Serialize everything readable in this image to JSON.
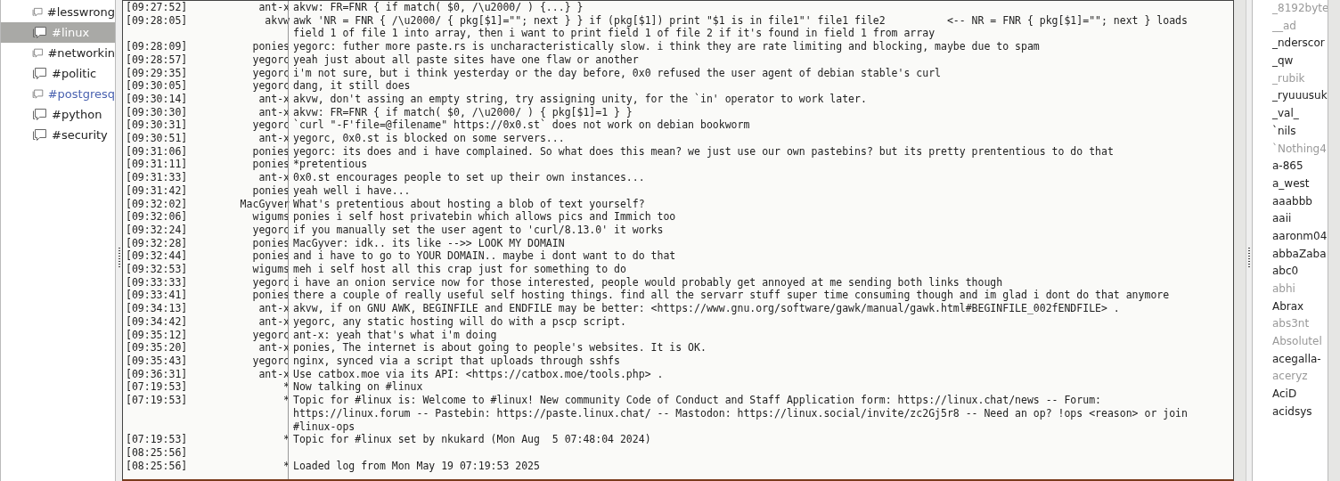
{
  "channels": [
    {
      "label": "#lesswrong",
      "selected": false,
      "activity": false
    },
    {
      "label": "#linux",
      "selected": true,
      "activity": false
    },
    {
      "label": "#networkin",
      "selected": false,
      "activity": false
    },
    {
      "label": "#politic",
      "selected": false,
      "activity": false
    },
    {
      "label": "#postgresq",
      "selected": false,
      "activity": true
    },
    {
      "label": "#python",
      "selected": false,
      "activity": false
    },
    {
      "label": "#security",
      "selected": false,
      "activity": false
    }
  ],
  "messages": [
    {
      "time": "[09:27:52]",
      "nick": "ant-x",
      "text": "akvw: FR=FNR { if match( $0, /\\u2000/ ) {...} }"
    },
    {
      "time": "[09:28:05]",
      "nick": "akvw",
      "text": "awk 'NR = FNR { /\\u2000/ { pkg[$1]=\"\"; next } } if (pkg[$1]) print \"$1 is in file1\"' file1 file2          <-- NR = FNR { pkg[$1]=\"\"; next } loads field 1 of file 1 into array, then i want to print field 1 of file 2 if it's found in field 1 from array"
    },
    {
      "time": "[09:28:09]",
      "nick": "ponies",
      "text": "yegorc: futher more paste.rs is uncharacteristically slow. i think they are rate limiting and blocking, maybe due to spam"
    },
    {
      "time": "[09:28:57]",
      "nick": "yegorc",
      "text": "yeah just about all paste sites have one flaw or another"
    },
    {
      "time": "[09:29:35]",
      "nick": "yegorc",
      "text": "i'm not sure, but i think yesterday or the day before, 0x0 refused the user agent of debian stable's curl"
    },
    {
      "time": "[09:30:05]",
      "nick": "yegorc",
      "text": "dang, it still does"
    },
    {
      "time": "[09:30:14]",
      "nick": "ant-x",
      "text": "akvw, don't assing an empty string, try assigning unity, for the `in' operator to work later."
    },
    {
      "time": "[09:30:30]",
      "nick": "ant-x",
      "text": "akvw: FR=FNR { if match( $0, /\\u2000/ ) { pkg[$1]=1 } }"
    },
    {
      "time": "[09:30:31]",
      "nick": "yegorc",
      "text": "`curl \"-F'file=@filename\" https://0x0.st` does not work on debian bookworm"
    },
    {
      "time": "[09:30:51]",
      "nick": "ant-x",
      "text": "yegorc, 0x0.st is blocked on some servers..."
    },
    {
      "time": "[09:31:06]",
      "nick": "ponies",
      "text": "yegorc: its does and i have complained. So what does this mean? we just use our own pastebins? but its pretty prententious to do that"
    },
    {
      "time": "[09:31:11]",
      "nick": "ponies",
      "text": "*pretentious"
    },
    {
      "time": "[09:31:33]",
      "nick": "ant-x",
      "text": "0x0.st encourages people to set up their own instances..."
    },
    {
      "time": "[09:31:42]",
      "nick": "ponies",
      "text": "yeah well i have..."
    },
    {
      "time": "[09:32:02]",
      "nick": "MacGyver",
      "text": "What's pretentious about hosting a blob of text yourself?"
    },
    {
      "time": "[09:32:06]",
      "nick": "wigums",
      "text": "ponies i self host privatebin which allows pics and Immich too"
    },
    {
      "time": "[09:32:24]",
      "nick": "yegorc",
      "text": "if you manually set the user agent to 'curl/8.13.0' it works"
    },
    {
      "time": "[09:32:28]",
      "nick": "ponies",
      "text": "MacGyver: idk.. its like -->> LOOK MY DOMAIN"
    },
    {
      "time": "[09:32:44]",
      "nick": "ponies",
      "text": "and i have to go to YOUR DOMAIN.. maybe i dont want to do that"
    },
    {
      "time": "[09:32:53]",
      "nick": "wigums",
      "text": "meh i self host all this crap just for something to do"
    },
    {
      "time": "[09:33:33]",
      "nick": "yegorc",
      "text": "i have an onion service now for those interested, people would probably get annoyed at me sending both links though"
    },
    {
      "time": "[09:33:41]",
      "nick": "ponies",
      "text": "there a couple of really useful self hosting things. find all the servarr stuff super time consuming though and im glad i dont do that anymore"
    },
    {
      "time": "[09:34:13]",
      "nick": "ant-x",
      "text": "akvw, if on GNU AWK, BEGINFILE and ENDFILE may be better: <https://www.gnu.org/software/gawk/manual/gawk.html#BEGINFILE_002fENDFILE> ."
    },
    {
      "time": "[09:34:42]",
      "nick": "ant-x",
      "text": "yegorc, any static hosting will do with a pscp script."
    },
    {
      "time": "[09:35:12]",
      "nick": "yegorc",
      "text": "ant-x: yeah that's what i'm doing"
    },
    {
      "time": "[09:35:20]",
      "nick": "ant-x",
      "text": "ponies, The internet is about going to people's websites. It is OK."
    },
    {
      "time": "[09:35:43]",
      "nick": "yegorc",
      "text": "nginx, synced via a script that uploads through sshfs"
    },
    {
      "time": "[09:36:31]",
      "nick": "ant-x",
      "text": "Use catbox.moe via its API: <https://catbox.moe/tools.php> ."
    },
    {
      "time": "[07:19:53]",
      "nick": "*",
      "text": "Now talking on #linux"
    },
    {
      "time": "[07:19:53]",
      "nick": "*",
      "text": "Topic for #linux is: Welcome to #linux! New community Code of Conduct and Staff Application form: https://linux.chat/news -- Forum: https://linux.forum -- Pastebin: https://paste.linux.chat/ -- Mastodon: https://linux.social/invite/zc2Gj5r8 -- Need an op? !ops <reason> or join #linux-ops"
    },
    {
      "time": "[07:19:53]",
      "nick": "*",
      "text": "Topic for #linux set by nkukard (Mon Aug  5 07:48:04 2024)"
    },
    {
      "time": "[08:25:56]"
    },
    {
      "time": "[08:25:56]",
      "nick": "*",
      "text": "Loaded log from Mon May 19 07:19:53 2025"
    }
  ],
  "nicks": [
    {
      "name": "_8192byte",
      "away": true
    },
    {
      "name": "__ad",
      "away": true
    },
    {
      "name": "_nderscor",
      "away": false
    },
    {
      "name": "_qw",
      "away": false
    },
    {
      "name": "_rubik",
      "away": true
    },
    {
      "name": "_ryuuusuk",
      "away": false
    },
    {
      "name": "_val_",
      "away": false
    },
    {
      "name": "`nils",
      "away": false
    },
    {
      "name": "`Nothing4",
      "away": true
    },
    {
      "name": "a-865",
      "away": false
    },
    {
      "name": "a_west",
      "away": false
    },
    {
      "name": "aaabbb",
      "away": false
    },
    {
      "name": "aaii",
      "away": false
    },
    {
      "name": "aaronm04",
      "away": false
    },
    {
      "name": "abbaZaba",
      "away": false
    },
    {
      "name": "abc0",
      "away": false
    },
    {
      "name": "abhi",
      "away": true
    },
    {
      "name": "Abrax",
      "away": false
    },
    {
      "name": "abs3nt",
      "away": true
    },
    {
      "name": "Absolutel",
      "away": true
    },
    {
      "name": "acegalla-",
      "away": false
    },
    {
      "name": "aceryz",
      "away": true
    },
    {
      "name": "AciD",
      "away": false
    },
    {
      "name": "acidsys",
      "away": false
    }
  ]
}
